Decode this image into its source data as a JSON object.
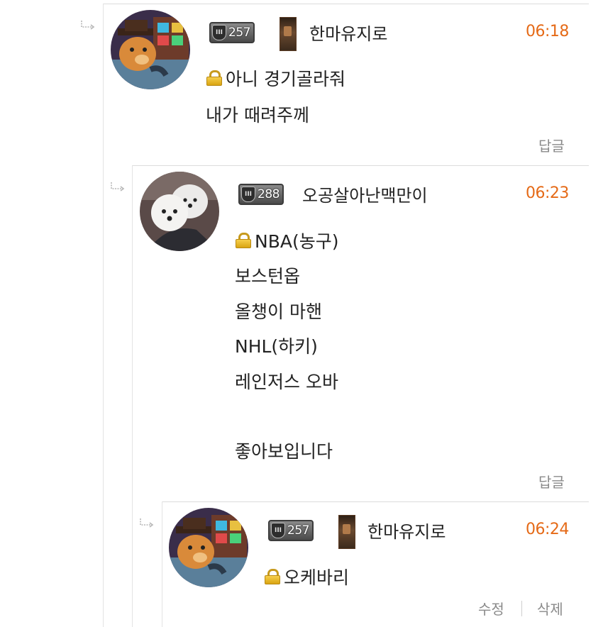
{
  "comments": [
    {
      "nickname": "한마유지로",
      "level": "257",
      "time": "06:18",
      "lines": [
        "아니 경기골라줘",
        "내가 때려주께"
      ],
      "reply_label": "답글",
      "avatar_icon": "bear-arcade-avatar"
    },
    {
      "nickname": "오공살아난맥만이",
      "level": "288",
      "time": "06:23",
      "lines": [
        "NBA(농구)",
        "보스턴옵",
        "올챙이 마핸",
        "NHL(하키)",
        "레인저스 오바",
        "",
        "좋아보입니다"
      ],
      "reply_label": "답글",
      "avatar_icon": "white-dogs-avatar"
    },
    {
      "nickname": "한마유지로",
      "level": "257",
      "time": "06:24",
      "lines": [
        "오케바리"
      ],
      "edit_label": "수정",
      "delete_label": "삭제",
      "avatar_icon": "bear-arcade-avatar"
    }
  ],
  "colors": {
    "time": "#e56a17",
    "lock": "#e8b52a",
    "divider": "#dcdcdc"
  }
}
